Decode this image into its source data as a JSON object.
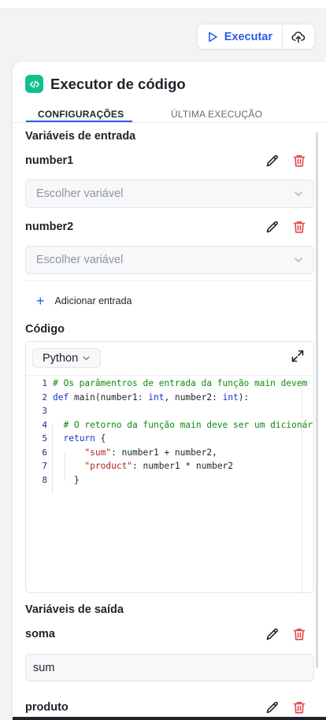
{
  "toolbar": {
    "run_label": "Executar"
  },
  "panel": {
    "title": "Executor de código"
  },
  "tabs": {
    "config": "CONFIGURAÇÕES",
    "last_run": "ÚLTIMA EXECUÇÃO"
  },
  "inputs": {
    "section_title": "Variáveis de entrada",
    "items": [
      {
        "name": "number1",
        "placeholder": "Escolher variável"
      },
      {
        "name": "number2",
        "placeholder": "Escolher variável"
      }
    ],
    "add_label": "Adicionar entrada"
  },
  "code": {
    "section_title": "Código",
    "language": "Python",
    "line_numbers": [
      "1",
      "2",
      "3",
      "4",
      "5",
      "6",
      "7",
      "8"
    ]
  },
  "outputs": {
    "section_title": "Variáveis de saída",
    "items": [
      {
        "name": "soma",
        "value": "sum"
      },
      {
        "name": "produto"
      }
    ]
  },
  "colors": {
    "accent": "#2a5ce6",
    "danger": "#e5484d",
    "node_icon": "#13bf8f",
    "code_comment": "#0f8a0f",
    "code_keyword": "#1b2fd4",
    "code_string": "#b3251d"
  }
}
